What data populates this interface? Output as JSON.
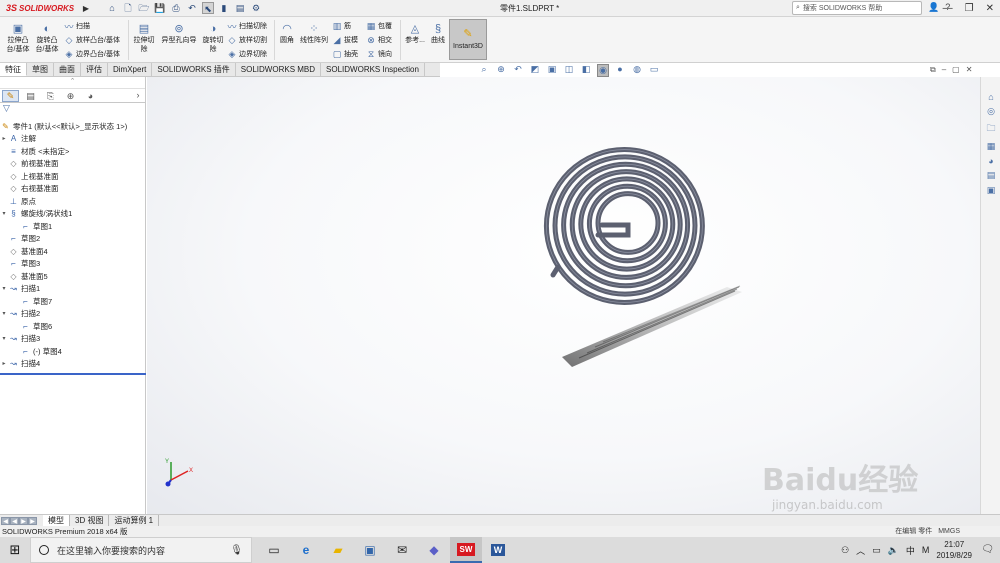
{
  "app": {
    "logo_text": "SOLIDWORKS",
    "logo_mark": "3S",
    "doc_title": "零件1.SLDPRT *"
  },
  "search": {
    "placeholder": "搜索 SOLIDWORKS 帮助"
  },
  "window_controls": {
    "minimize": "—",
    "restore": "❐",
    "close": "✕"
  },
  "ribbon": {
    "extruded_boss": "拉伸凸\n台/基体",
    "revolved_boss": "旋转凸\n台/基体",
    "swept_boss": "扫描",
    "lofted_boss": "放样凸台/基体",
    "boundary_boss": "边界凸台/基体",
    "extruded_cut": "拉伸切\n除",
    "hole_wizard": "异型孔向导",
    "revolved_cut": "旋转切\n除",
    "swept_cut": "扫描切除",
    "lofted_cut": "放样切割",
    "boundary_cut": "边界切除",
    "fillet": "圆角",
    "linear_pattern": "线性阵列",
    "rib": "筋",
    "draft": "拔模",
    "shell": "抽壳",
    "wrap": "包覆",
    "intersect": "相交",
    "mirror": "镜向",
    "reference": "参考...",
    "curves": "曲线",
    "instant3d": "Instant3D"
  },
  "tabs": [
    "特征",
    "草图",
    "曲面",
    "评估",
    "DimXpert",
    "SOLIDWORKS 插件",
    "SOLIDWORKS MBD",
    "SOLIDWORKS Inspection"
  ],
  "tree": {
    "root": "零件1 (默认<<默认>_显示状态 1>)",
    "items": [
      {
        "label": "注解",
        "icon": "annotation-icon",
        "indent": 1,
        "exp": "▸"
      },
      {
        "label": "材质 <未指定>",
        "icon": "material-icon",
        "indent": 1,
        "exp": ""
      },
      {
        "label": "前视基准面",
        "icon": "plane-icon",
        "indent": 1,
        "exp": ""
      },
      {
        "label": "上视基准面",
        "icon": "plane-icon",
        "indent": 1,
        "exp": ""
      },
      {
        "label": "右视基准面",
        "icon": "plane-icon",
        "indent": 1,
        "exp": ""
      },
      {
        "label": "原点",
        "icon": "origin-icon",
        "indent": 1,
        "exp": ""
      },
      {
        "label": "螺旋线/涡状线1",
        "icon": "helix-icon",
        "indent": 1,
        "exp": "▾"
      },
      {
        "label": "草图1",
        "icon": "sketch-icon",
        "indent": 2,
        "exp": ""
      },
      {
        "label": "草图2",
        "icon": "sketch-icon",
        "indent": 1,
        "exp": ""
      },
      {
        "label": "基准面4",
        "icon": "plane-icon",
        "indent": 1,
        "exp": ""
      },
      {
        "label": "草图3",
        "icon": "sketch-icon",
        "indent": 1,
        "exp": ""
      },
      {
        "label": "基准面5",
        "icon": "plane-icon",
        "indent": 1,
        "exp": ""
      },
      {
        "label": "扫描1",
        "icon": "sweep-icon",
        "indent": 1,
        "exp": "▾"
      },
      {
        "label": "草图7",
        "icon": "sketch-icon",
        "indent": 2,
        "exp": ""
      },
      {
        "label": "扫描2",
        "icon": "sweep-icon",
        "indent": 1,
        "exp": "▾"
      },
      {
        "label": "草图6",
        "icon": "sketch-icon",
        "indent": 2,
        "exp": ""
      },
      {
        "label": "扫描3",
        "icon": "sweep-icon",
        "indent": 1,
        "exp": "▾"
      },
      {
        "label": "(-) 草图4",
        "icon": "sketch-icon",
        "indent": 2,
        "exp": ""
      },
      {
        "label": "扫描4",
        "icon": "sweep-icon",
        "indent": 1,
        "exp": "▸"
      }
    ]
  },
  "bottom_tabs": [
    "模型",
    "3D 视图",
    "运动算例 1"
  ],
  "status": {
    "text": "SOLIDWORKS Premium 2018 x64 版",
    "edit_mode": "在编辑 零件",
    "units": "MMGS"
  },
  "taskbar": {
    "search_placeholder": "在这里输入你要搜索的内容",
    "ime": "中",
    "ime_mode": "M",
    "time": "21:07",
    "date": "2019/8/29"
  },
  "watermark": {
    "brand": "Baidu经验",
    "url": "jingyan.baidu.com"
  },
  "colors": {
    "model": "#5c6070",
    "accent": "#3a64a8",
    "ribbon_bg": "#f5f5f5",
    "sw_red": "#d71920"
  }
}
